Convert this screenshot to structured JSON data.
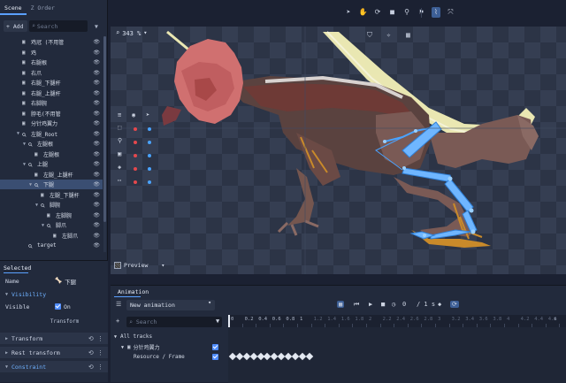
{
  "scene_panel": {
    "tabs": [
      {
        "label": "Scene"
      },
      {
        "label": "Z Order"
      }
    ],
    "add_label": "+ Add",
    "search_placeholder": "Search",
    "tree": [
      {
        "label": "鸡冠 (不用管",
        "type": "image",
        "depth": 1
      },
      {
        "label": "鸡",
        "type": "image",
        "depth": 1
      },
      {
        "label": "右腿根",
        "type": "image",
        "depth": 1
      },
      {
        "label": "右爪",
        "type": "image",
        "depth": 1
      },
      {
        "label": "右腿_下腿杆",
        "type": "image",
        "depth": 1
      },
      {
        "label": "右腿_上腿杆",
        "type": "image",
        "depth": 1
      },
      {
        "label": "右脚腕",
        "type": "image",
        "depth": 1
      },
      {
        "label": "脖毛(不用管",
        "type": "image",
        "depth": 1
      },
      {
        "label": "分针鸡翼力",
        "type": "image",
        "depth": 1
      },
      {
        "label": "左腿_Root",
        "type": "bone",
        "depth": 1,
        "expanded": true
      },
      {
        "label": "左腿根",
        "type": "bone",
        "depth": 2,
        "expanded": true
      },
      {
        "label": "左腿根",
        "type": "image",
        "depth": 3
      },
      {
        "label": "上腿",
        "type": "bone",
        "depth": 2,
        "expanded": true
      },
      {
        "label": "左腿_上腿杆",
        "type": "image",
        "depth": 3
      },
      {
        "label": "下腿",
        "type": "bone",
        "depth": 3,
        "expanded": true,
        "selected": true
      },
      {
        "label": "左腿_下腿杆",
        "type": "image",
        "depth": 4
      },
      {
        "label": "脚腕",
        "type": "bone",
        "depth": 4,
        "expanded": true
      },
      {
        "label": "左脚腕",
        "type": "image",
        "depth": 5
      },
      {
        "label": "脚爪",
        "type": "bone",
        "depth": 5,
        "expanded": true
      },
      {
        "label": "左脚爪",
        "type": "image",
        "depth": 6
      },
      {
        "label": "target",
        "type": "bone",
        "depth": 2
      }
    ]
  },
  "selected_panel": {
    "title": "Selected",
    "name_label": "Name",
    "name_value": "下腿",
    "visibility_label": "Visibility",
    "visible_label": "Visible",
    "visible_value": "On",
    "transform_button": "Transform",
    "sections": [
      {
        "label": "Transform"
      },
      {
        "label": "Rest transform"
      },
      {
        "label": "Constraint"
      }
    ]
  },
  "toolbar": {
    "tools": [
      {
        "icon": "pointer-icon"
      },
      {
        "icon": "hand-icon"
      },
      {
        "icon": "rotate-icon"
      },
      {
        "icon": "square-icon"
      },
      {
        "icon": "bone-icon"
      },
      {
        "icon": "pin-icon"
      },
      {
        "icon": "ik-icon",
        "active": true
      },
      {
        "icon": "transform-icon"
      }
    ]
  },
  "viewport": {
    "zoom_label": "343 %",
    "preview_label": "Preview",
    "layers": [
      {
        "icon": "frame-icon",
        "dot1": "#e5484d",
        "dot2": "#4aa3ff"
      },
      {
        "icon": "bone-icon",
        "dot1": "#e5484d",
        "dot2": "#4aa3ff"
      },
      {
        "icon": "image-icon",
        "dot1": "#e5484d",
        "dot2": "#4aa3ff"
      },
      {
        "icon": "layers-icon",
        "dot1": "#e5484d",
        "dot2": "#4aa3ff"
      },
      {
        "icon": "more-icon",
        "dot1": "#e5484d",
        "dot2": "#4aa3ff"
      }
    ],
    "colors": {
      "bone": "#4aa3ff",
      "accent": "#5aa0ff",
      "head": "#d07070",
      "body": "#7a5a55"
    }
  },
  "animation": {
    "tab_label": "Animation",
    "animation_name": "New animation",
    "frame_value": "0",
    "frame_total": "/ 1 s",
    "search_placeholder": "Search",
    "ruler": [
      "0",
      "0.2",
      "0.4",
      "0.6",
      "0.8",
      "1",
      "1.2",
      "1.4",
      "1.6",
      "1.8",
      "2",
      "2.2",
      "2.4",
      "2.6",
      "2.8",
      "3",
      "3.2",
      "3.4",
      "3.6",
      "3.8",
      "4",
      "4.2",
      "4.4",
      "4.6",
      "s"
    ],
    "tracks_label": "All tracks",
    "track_group": "分针鸡翼力",
    "track_item": "Resource / Frame",
    "keyframe_count": 12
  }
}
